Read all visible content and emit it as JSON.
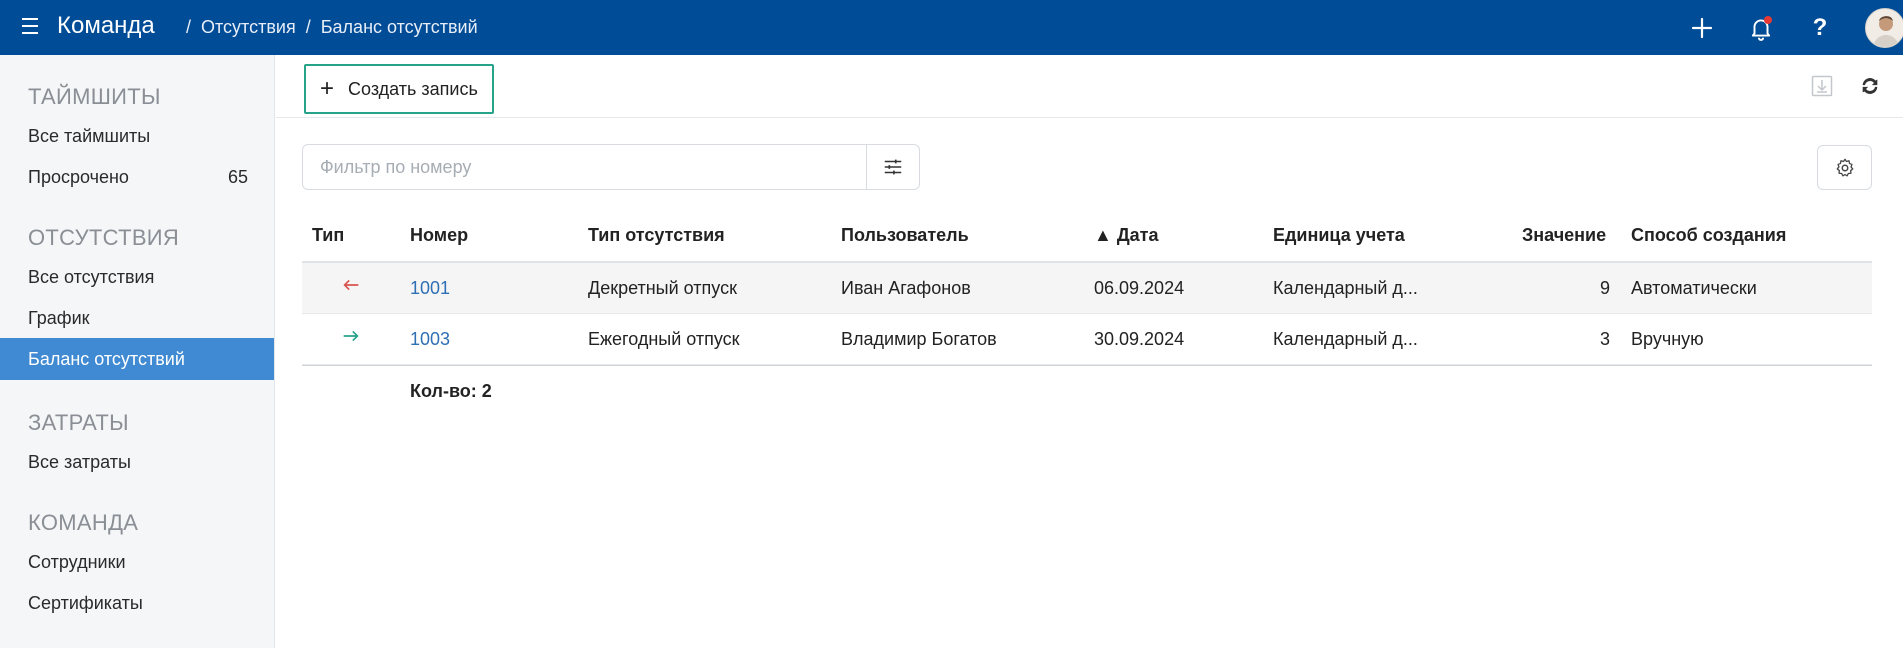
{
  "header": {
    "app_title": "Команда",
    "breadcrumbs": [
      "Отсутствия",
      "Баланс отсутствий"
    ],
    "separator": "/",
    "help_label": "?",
    "accent": "#004c97"
  },
  "sidebar": {
    "sections": [
      {
        "title": "ТАЙМШИТЫ",
        "items": [
          {
            "label": "Все таймшиты"
          },
          {
            "label": "Просрочено",
            "count": "65"
          }
        ]
      },
      {
        "title": "ОТСУТСТВИЯ",
        "items": [
          {
            "label": "Все отсутствия"
          },
          {
            "label": "График"
          },
          {
            "label": "Баланс отсутствий",
            "active": true
          }
        ]
      },
      {
        "title": "ЗАТРАТЫ",
        "items": [
          {
            "label": "Все затраты"
          }
        ]
      },
      {
        "title": "КОМАНДА",
        "items": [
          {
            "label": "Сотрудники"
          },
          {
            "label": "Сертификаты"
          }
        ]
      }
    ]
  },
  "toolbar": {
    "create_label": "Создать запись",
    "create_plus": "+"
  },
  "filter": {
    "placeholder": "Фильтр по номеру",
    "value": ""
  },
  "table": {
    "columns": [
      "Тип",
      "Номер",
      "Тип отсутствия",
      "Пользователь",
      "▲ Дата",
      "Единица учета",
      "Значение",
      "Способ создания"
    ],
    "rows": [
      {
        "type_icon": "arrow-left-icon",
        "type_color": "#d9534f",
        "number": "1001",
        "absence_type": "Декретный отпуск",
        "user": "Иван Агафонов",
        "date": "06.09.2024",
        "unit": "Календарный д...",
        "value": "9",
        "method": "Автоматически"
      },
      {
        "type_icon": "arrow-right-icon",
        "type_color": "#27a38a",
        "number": "1003",
        "absence_type": "Ежегодный отпуск",
        "user": "Владимир Богатов",
        "date": "30.09.2024",
        "unit": "Календарный д...",
        "value": "3",
        "method": "Вручную"
      }
    ],
    "total_label": "Кол-во: 2"
  }
}
